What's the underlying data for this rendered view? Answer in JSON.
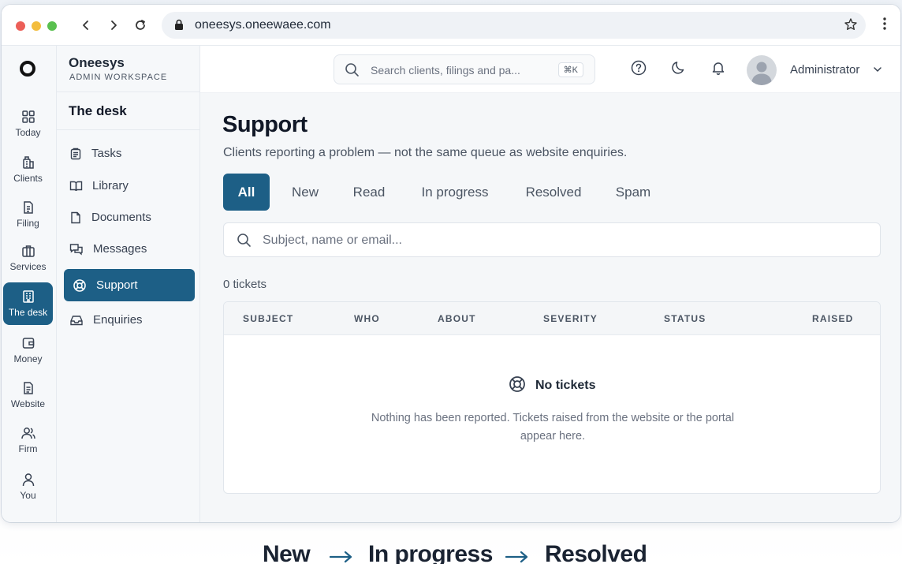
{
  "browser": {
    "url": "oneesys.oneewaee.com"
  },
  "brand": {
    "name": "Oneesys",
    "subtitle": "ADMIN WORKSPACE"
  },
  "rail": {
    "items": [
      {
        "label": "Today",
        "icon": "grid-icon"
      },
      {
        "label": "Clients",
        "icon": "building-icon"
      },
      {
        "label": "Filing",
        "icon": "file-icon"
      },
      {
        "label": "Services",
        "icon": "briefcase-icon"
      },
      {
        "label": "The desk",
        "icon": "desk-icon",
        "active": true
      },
      {
        "label": "Money",
        "icon": "wallet-icon"
      },
      {
        "label": "Website",
        "icon": "page-icon"
      },
      {
        "label": "Firm",
        "icon": "users-icon"
      },
      {
        "label": "You",
        "icon": "user-icon"
      }
    ]
  },
  "sidebar": {
    "section_title": "The desk",
    "items": [
      {
        "label": "Tasks",
        "icon": "clipboard-icon"
      },
      {
        "label": "Library",
        "icon": "book-icon"
      },
      {
        "label": "Documents",
        "icon": "document-icon"
      },
      {
        "label": "Messages",
        "icon": "chat-icon"
      },
      {
        "label": "Support",
        "icon": "lifebuoy-icon",
        "active": true
      },
      {
        "label": "Enquiries",
        "icon": "inbox-icon"
      }
    ]
  },
  "header": {
    "search_placeholder": "Search clients, filings and pa...",
    "shortcut": "⌘K",
    "user_name": "Administrator"
  },
  "main": {
    "title": "Support",
    "subtitle": "Clients reporting a problem — not the same queue as website enquiries.",
    "tabs": [
      {
        "label": "All",
        "active": true
      },
      {
        "label": "New"
      },
      {
        "label": "Read"
      },
      {
        "label": "In progress"
      },
      {
        "label": "Resolved"
      },
      {
        "label": "Spam"
      }
    ],
    "filter_placeholder": "Subject, name or email...",
    "count": "0 tickets",
    "columns": [
      "SUBJECT",
      "WHO",
      "ABOUT",
      "SEVERITY",
      "STATUS",
      "RAISED"
    ],
    "empty_title": "No tickets",
    "empty_text": "Nothing has been reported. Tickets raised from the website or the portal appear here."
  },
  "flow": {
    "steps": [
      "New",
      "In progress",
      "Resolved"
    ]
  },
  "colors": {
    "accent": "#1d5f86"
  }
}
